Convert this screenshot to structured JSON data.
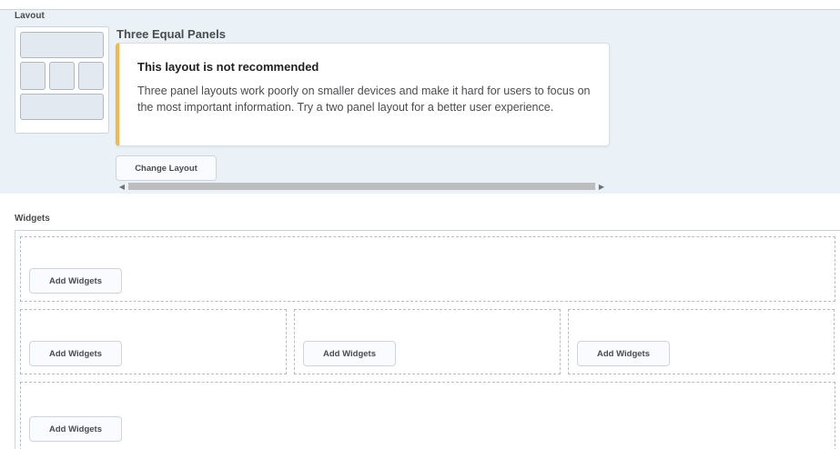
{
  "layout": {
    "section_label": "Layout",
    "selected_title": "Three Equal Panels",
    "alert": {
      "title": "This layout is not recommended",
      "body": "Three panel layouts work poorly on smaller devices and make it hard for users to focus on the most important information. Try a two panel layout for a better user experience."
    },
    "change_layout_label": "Change Layout",
    "accent_color": "#f4b74c"
  },
  "widgets": {
    "section_label": "Widgets",
    "panels": [
      {
        "button_label": "Add Widgets"
      },
      {
        "button_label": "Add Widgets"
      },
      {
        "button_label": "Add Widgets"
      },
      {
        "button_label": "Add Widgets"
      },
      {
        "button_label": "Add Widgets"
      }
    ]
  },
  "scrollbar": {
    "left_icon": "scroll-left-arrow-icon",
    "right_icon": "scroll-right-arrow-icon"
  }
}
